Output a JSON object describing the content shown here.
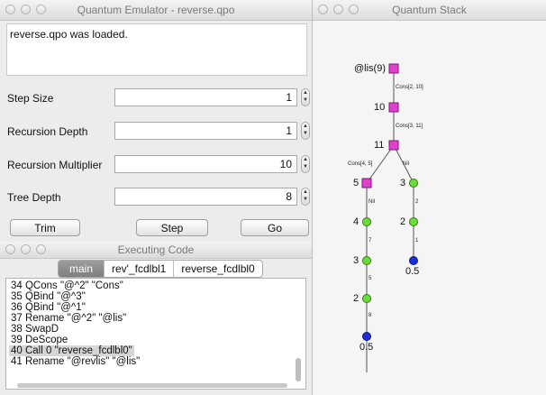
{
  "emulator": {
    "title": "Quantum Emulator - reverse.qpo",
    "message": "reverse.qpo was loaded.",
    "fields": [
      {
        "label": "Step Size",
        "value": "1"
      },
      {
        "label": "Recursion Depth",
        "value": "1"
      },
      {
        "label": "Recursion Multiplier",
        "value": "10"
      },
      {
        "label": "Tree Depth",
        "value": "8"
      }
    ],
    "buttons": {
      "trim": "Trim",
      "step": "Step",
      "go": "Go"
    }
  },
  "executing": {
    "title": "Executing Code",
    "tabs": [
      "main",
      "rev'_fcdlbl1",
      "reverse_fcdlbl0"
    ],
    "active_tab": "main",
    "code_lines": [
      "34 QCons \"@^2\" \"Cons\"",
      "35 QBind \"@^3\"",
      "36 QBind \"@^1\"",
      "37 Rename \"@^2\" \"@lis\"",
      "38 SwapD",
      "39 DeScope",
      "40 Call 0 \"reverse_fcdlbl0\"",
      "41 Rename \"@revlis\" \"@lis\""
    ],
    "selected_line": 6
  },
  "stack": {
    "title": "Quantum Stack",
    "nodes": {
      "root": "@lis(9)",
      "n10": "10",
      "n11": "11",
      "n5": "5",
      "n4": "4",
      "n3a": "3",
      "n2a": "2",
      "n3b": "3",
      "n2b": "2",
      "leaf_a": "0.5",
      "leaf_b": "0.5"
    },
    "edges": {
      "cons_2_10": "Cons[2, 10]",
      "cons_3_11": "Cons[3, 11]",
      "cons_4_5": "Cons[4, 5]",
      "nil_right": "Nil",
      "nil_left": "Nil",
      "e7": "7",
      "e5": "5",
      "e8": "8",
      "e2": "2",
      "e1": "1"
    },
    "colors": {
      "cons": "#e040d0",
      "value": "#6cdc3a",
      "leaf": "#1a2fd6"
    }
  }
}
